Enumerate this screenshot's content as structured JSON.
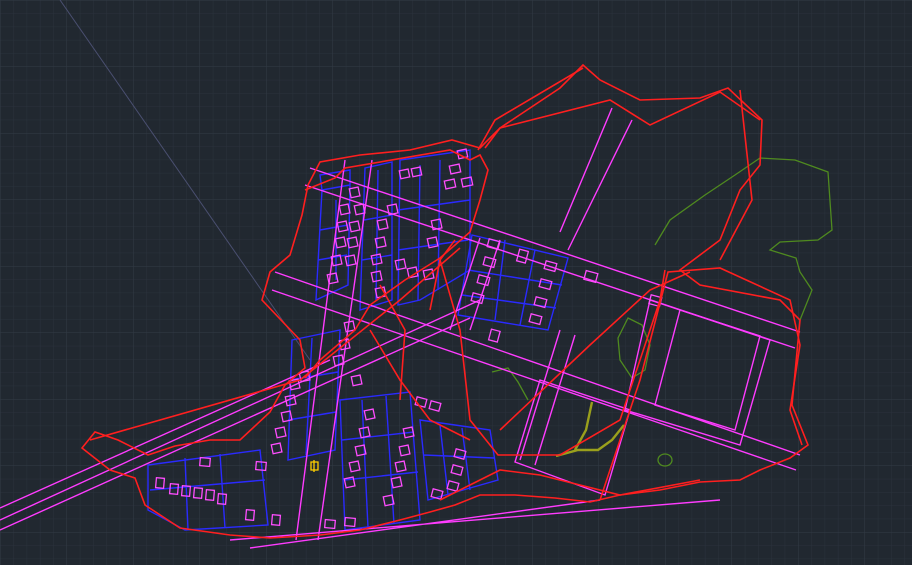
{
  "app": {
    "kind": "cad-model-space",
    "visible_text": []
  },
  "colors": {
    "background": "#212830",
    "grid_minor": "#2a323c",
    "grid_major": "#323b46",
    "boundary": "#ff1f1f",
    "roads": "#ff3cff",
    "parcels": "#2a2aff",
    "buildings": "#ff4dff",
    "vegetation": "#4f8a1f",
    "accent_path": "#9aa01c",
    "marker": "#ffd000",
    "construction_line": "#4a4f70"
  },
  "drawing": {
    "layers": [
      "boundary",
      "roads",
      "parcels",
      "buildings",
      "vegetation",
      "accent-path",
      "marker"
    ]
  }
}
